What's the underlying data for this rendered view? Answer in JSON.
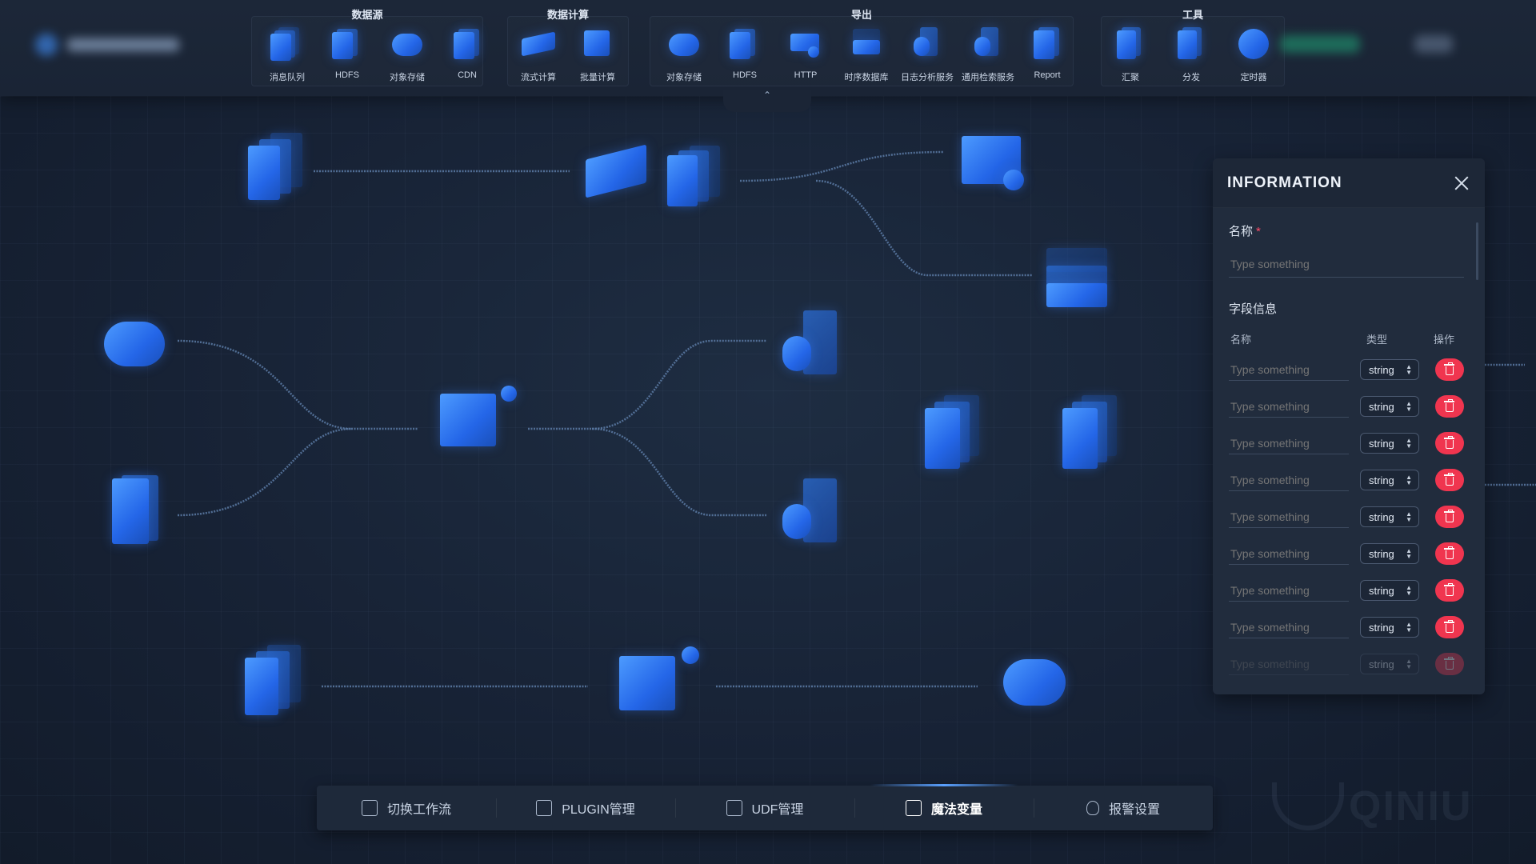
{
  "toolbar": {
    "groups": [
      {
        "title": "数据源",
        "tools": [
          {
            "label": "消息队列",
            "icon": "message-queue-icon"
          },
          {
            "label": "HDFS",
            "icon": "hdfs-icon"
          },
          {
            "label": "对象存储",
            "icon": "object-storage-icon"
          },
          {
            "label": "CDN",
            "icon": "cdn-icon"
          }
        ]
      },
      {
        "title": "数据计算",
        "tools": [
          {
            "label": "流式计算",
            "icon": "stream-compute-icon"
          },
          {
            "label": "批量计算",
            "icon": "batch-compute-icon"
          }
        ]
      },
      {
        "title": "导出",
        "tools": [
          {
            "label": "对象存储",
            "icon": "object-storage-icon"
          },
          {
            "label": "HDFS",
            "icon": "hdfs-icon"
          },
          {
            "label": "HTTP",
            "icon": "http-icon"
          },
          {
            "label": "时序数据库",
            "icon": "tsdb-icon"
          },
          {
            "label": "日志分析服务",
            "icon": "log-analysis-icon"
          },
          {
            "label": "通用检索服务",
            "icon": "search-service-icon"
          },
          {
            "label": "Report",
            "icon": "report-icon"
          }
        ]
      },
      {
        "title": "工具",
        "tools": [
          {
            "label": "汇聚",
            "icon": "merge-icon"
          },
          {
            "label": "分发",
            "icon": "distribute-icon"
          },
          {
            "label": "定时器",
            "icon": "timer-icon"
          }
        ]
      }
    ],
    "collapse_glyph": "⌃"
  },
  "panel": {
    "title": "INFORMATION",
    "name_label": "名称",
    "required_mark": "*",
    "name_placeholder": "Type something",
    "fields_section": "字段信息",
    "columns": {
      "name": "名称",
      "type": "类型",
      "action": "操作"
    },
    "rows": [
      {
        "placeholder": "Type something",
        "type": "string"
      },
      {
        "placeholder": "Type something",
        "type": "string"
      },
      {
        "placeholder": "Type something",
        "type": "string"
      },
      {
        "placeholder": "Type something",
        "type": "string"
      },
      {
        "placeholder": "Type something",
        "type": "string"
      },
      {
        "placeholder": "Type something",
        "type": "string"
      },
      {
        "placeholder": "Type something",
        "type": "string"
      },
      {
        "placeholder": "Type something",
        "type": "string"
      },
      {
        "placeholder": "Type something",
        "type": "string"
      }
    ]
  },
  "bottom_bar": {
    "items": [
      {
        "label": "切换工作流",
        "icon": "switch-workflow-icon",
        "active": false
      },
      {
        "label": "PLUGIN管理",
        "icon": "plugin-icon",
        "active": false
      },
      {
        "label": "UDF管理",
        "icon": "udf-icon",
        "active": false
      },
      {
        "label": "魔法变量",
        "icon": "magic-variable-icon",
        "active": true
      },
      {
        "label": "报警设置",
        "icon": "alert-bulb-icon",
        "active": false
      }
    ]
  },
  "watermark": "QINIU",
  "colors": {
    "accent": "#3a7bff",
    "danger": "#f0354f",
    "background": "#172235",
    "panel": "#212c3d"
  }
}
